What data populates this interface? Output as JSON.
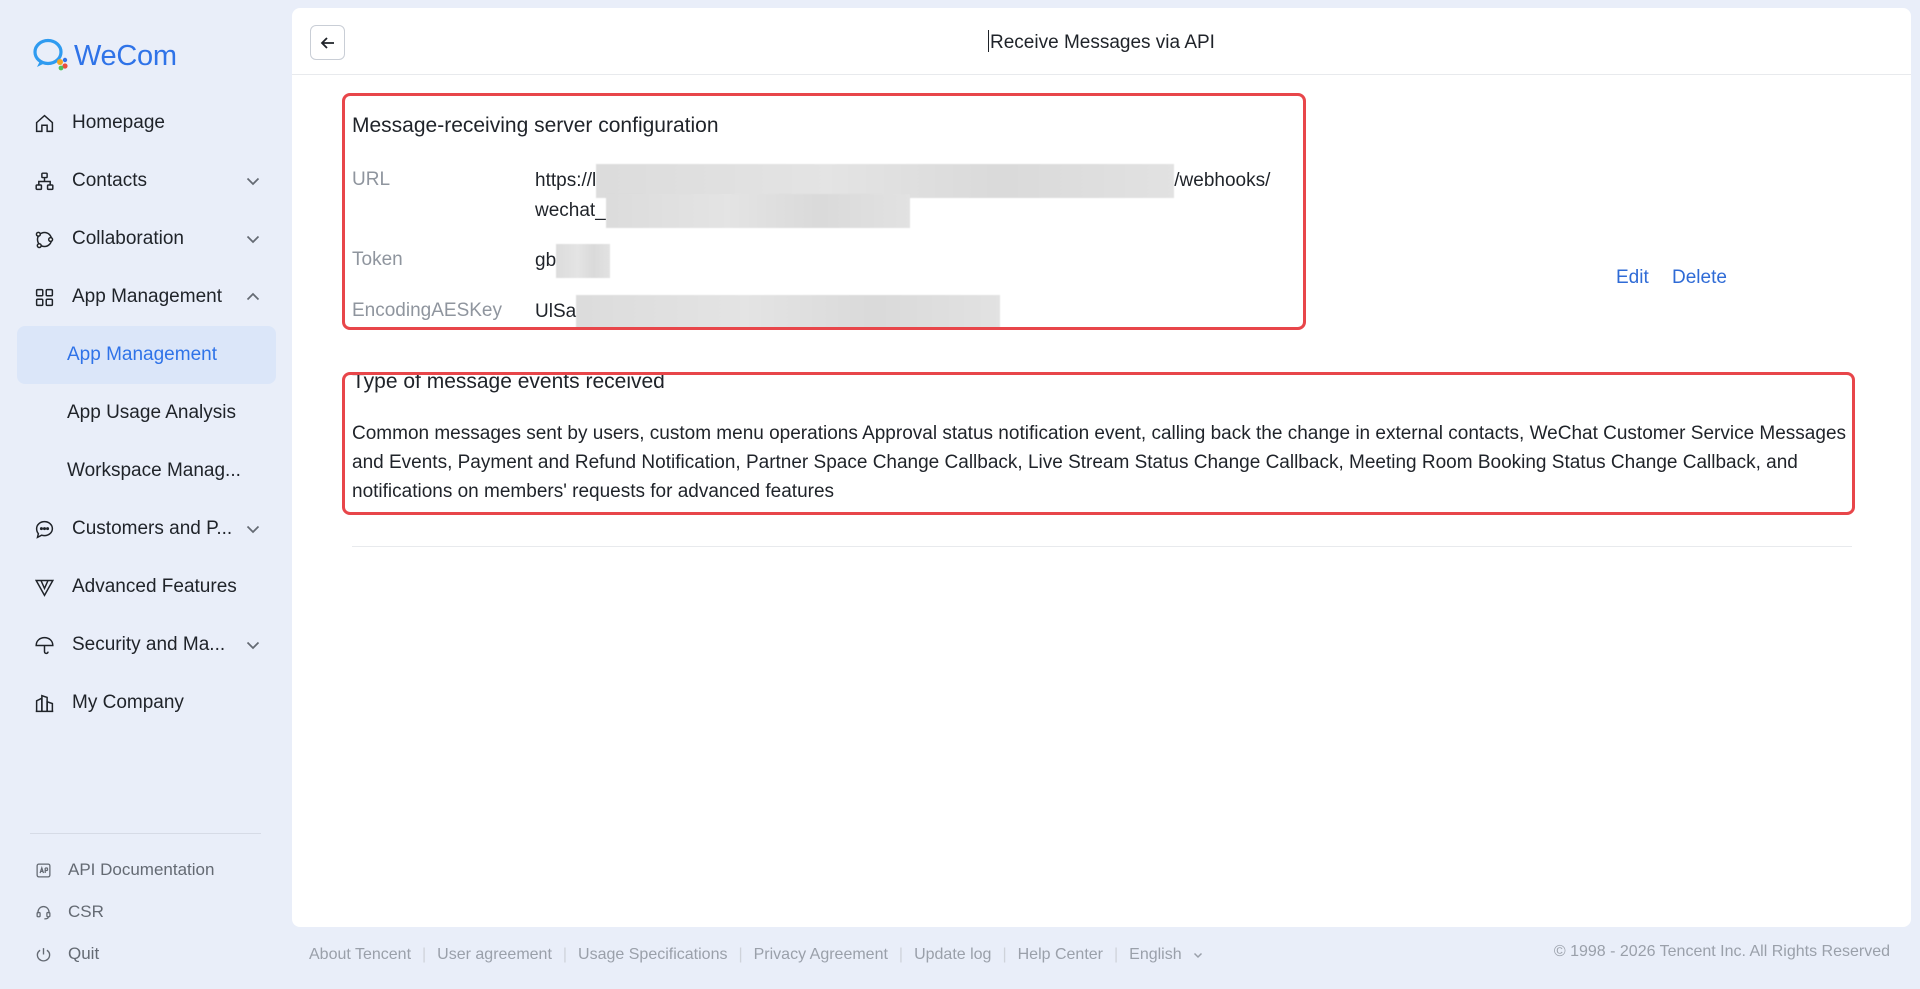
{
  "brand": {
    "name": "WeCom",
    "accent": "#2f73e8"
  },
  "sidebar": {
    "items": [
      {
        "label": "Homepage",
        "icon": "home-icon"
      },
      {
        "label": "Contacts",
        "icon": "org-chart-icon",
        "expandable": true
      },
      {
        "label": "Collaboration",
        "icon": "collaboration-icon",
        "expandable": true
      },
      {
        "label": "App Management",
        "icon": "apps-grid-icon",
        "expanded": true
      },
      {
        "label": "App Management",
        "sub": true,
        "active": true
      },
      {
        "label": "App Usage Analysis",
        "sub": true
      },
      {
        "label": "Workspace Manag...",
        "sub": true
      },
      {
        "label": "Customers and P...",
        "icon": "chat-bubble-icon",
        "expandable": true
      },
      {
        "label": "Advanced Features",
        "icon": "advanced-features-icon"
      },
      {
        "label": "Security and Ma...",
        "icon": "umbrella-icon",
        "expandable": true
      },
      {
        "label": "My Company",
        "icon": "company-building-icon"
      }
    ],
    "bottom": [
      {
        "label": "API Documentation",
        "icon": "api-doc-icon"
      },
      {
        "label": "CSR",
        "icon": "headset-icon"
      },
      {
        "label": "Quit",
        "icon": "power-icon"
      }
    ]
  },
  "header": {
    "title": "Receive Messages via API"
  },
  "server_config": {
    "title": "Message-receiving server configuration",
    "fields": [
      {
        "label": "URL",
        "value_start": "https://l",
        "value_mid": "/webhooks/",
        "value_line2": "wechat_"
      },
      {
        "label": "Token",
        "value": "gb"
      },
      {
        "label": "EncodingAESKey",
        "value": "UlSa"
      }
    ],
    "edit_label": "Edit",
    "delete_label": "Delete"
  },
  "events": {
    "title": "Type of message events received",
    "description": "Common messages sent by users, custom menu operations Approval status notification event, calling back the change in external contacts, WeChat Customer Service Messages and Events, Payment and Refund Notification, Partner Space Change Callback, Live Stream Status Change Callback, Meeting Room Booking Status Change Callback, and notifications on members' requests for advanced features"
  },
  "footer": {
    "links": [
      "About Tencent",
      "User agreement",
      "Usage Specifications",
      "Privacy Agreement",
      "Update log",
      "Help Center"
    ],
    "language": "English",
    "copyright": "© 1998 - 2026 Tencent Inc. All Rights Reserved"
  },
  "colors": {
    "highlight": "#e8464a",
    "link": "#2f6bd6",
    "background": "#e9eef9"
  }
}
